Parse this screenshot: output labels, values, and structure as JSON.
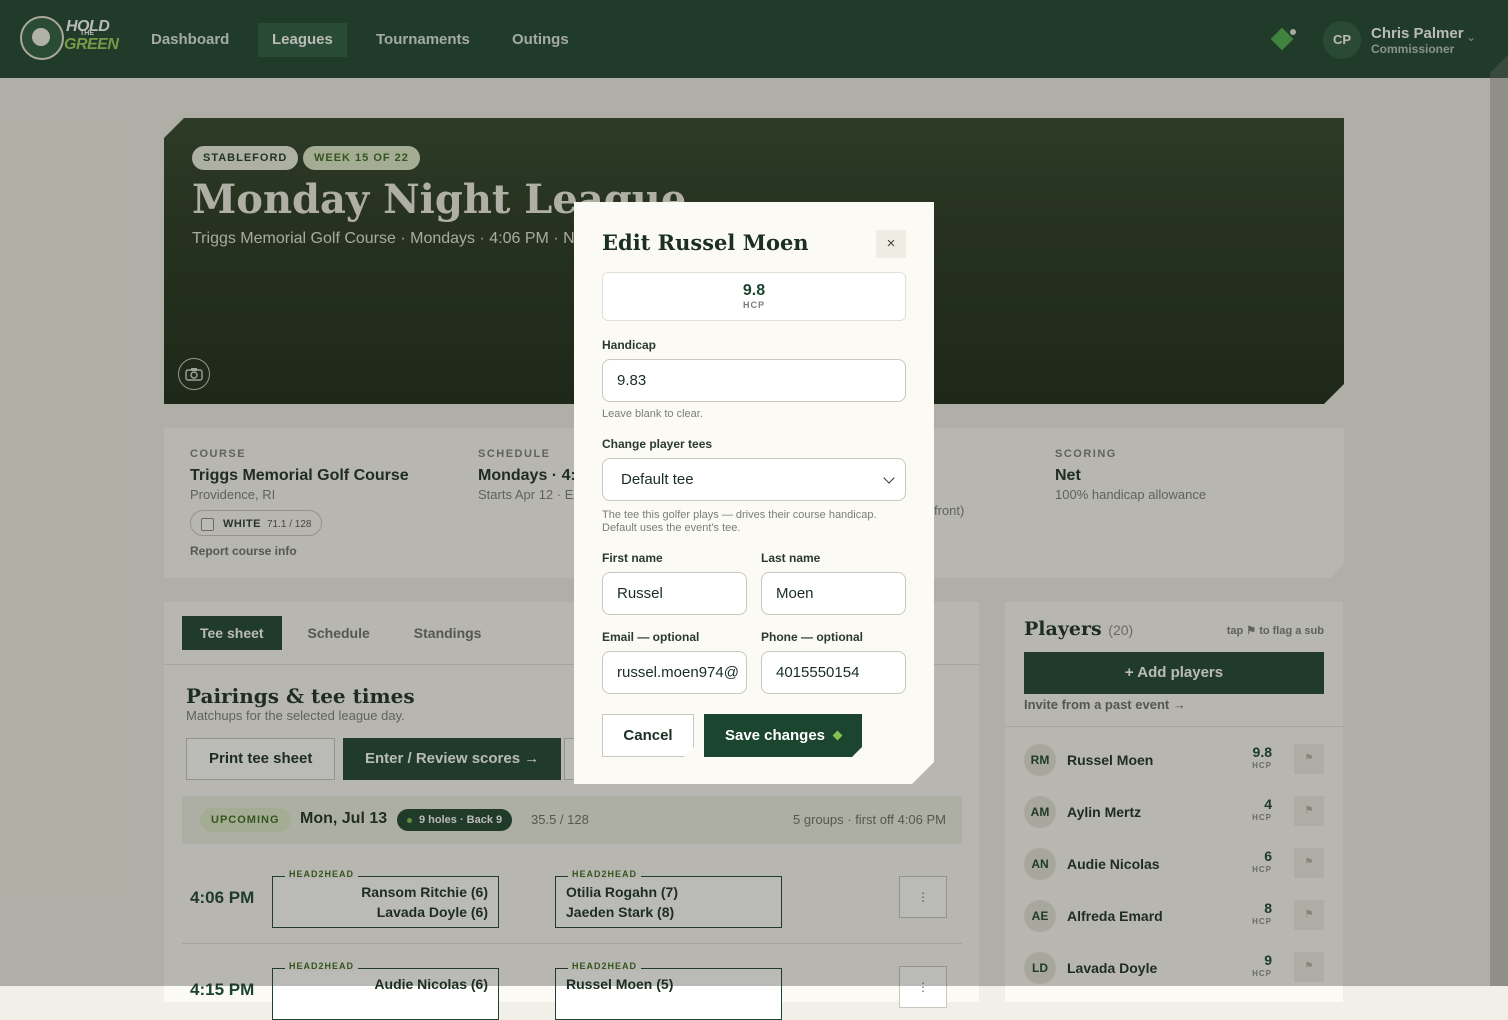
{
  "nav": {
    "logo_line1": "HOLD",
    "logo_line2": "THE",
    "logo_line3": "GREEN",
    "links": [
      "Dashboard",
      "Leagues",
      "Tournaments",
      "Outings"
    ],
    "active": "Leagues",
    "user_initials": "CP",
    "user_name": "Chris Palmer",
    "user_role": "Commissioner"
  },
  "hero": {
    "format_pill": "STABLEFORD",
    "week_pill": "WEEK 15 OF 22",
    "title": "Monday Night League",
    "subtitle": "Triggs Memorial Golf Course · Mondays · 4:06 PM · N"
  },
  "info": {
    "course_label": "COURSE",
    "course_name": "Triggs Memorial Golf Course",
    "course_location": "Providence, RI",
    "tee_name": "WHITE",
    "tee_rating": "71.1 / 128",
    "report_link": "Report course info",
    "schedule_label": "SCHEDULE",
    "schedule_value": "Mondays · 4:",
    "schedule_sub": "Starts Apr 12 · E",
    "holes_peek": "front)",
    "scoring_label": "SCORING",
    "scoring_value": "Net",
    "scoring_sub": "100% handicap allowance"
  },
  "main": {
    "tabs": [
      "Tee sheet",
      "Schedule",
      "Standings"
    ],
    "active_tab": "Tee sheet",
    "section_title": "Pairings & tee times",
    "section_sub": "Matchups for the selected league day.",
    "print_button": "Print tee sheet",
    "enter_button": "Enter / Review scores →",
    "day": {
      "status": "UPCOMING",
      "date": "Mon, Jul 13",
      "holes": "9 holes · Back 9",
      "rating": "35.5 / 128",
      "summary": "5 groups · first off 4:06 PM"
    },
    "tee_times": [
      {
        "time": "4:06 PM",
        "matches": [
          {
            "tag": "HEAD2HEAD",
            "p1": "Ransom Ritchie (6)",
            "p2": "Lavada Doyle (6)"
          },
          {
            "tag": "HEAD2HEAD",
            "p1": "Otilia Rogahn (7)",
            "p2": "Jaeden Stark (8)"
          }
        ],
        "menu": "⋮"
      },
      {
        "time": "4:15 PM",
        "matches": [
          {
            "tag": "HEAD2HEAD",
            "p1": "Audie Nicolas (6)",
            "p2": ""
          },
          {
            "tag": "HEAD2HEAD",
            "p1": "Russel Moen (5)",
            "p2": ""
          }
        ],
        "menu": "⋮"
      }
    ]
  },
  "players": {
    "title": "Players",
    "count": "(20)",
    "hint": "tap ⚑ to flag a sub",
    "add_button": "+ Add players",
    "invite_link": "Invite from a past event →",
    "hcp_label": "HCP",
    "list": [
      {
        "initials": "RM",
        "name": "Russel Moen",
        "hcp": "9.8"
      },
      {
        "initials": "AM",
        "name": "Aylin Mertz",
        "hcp": "4"
      },
      {
        "initials": "AN",
        "name": "Audie Nicolas",
        "hcp": "6"
      },
      {
        "initials": "AE",
        "name": "Alfreda Emard",
        "hcp": "8"
      },
      {
        "initials": "LD",
        "name": "Lavada Doyle",
        "hcp": "9"
      }
    ]
  },
  "modal": {
    "title": "Edit Russel Moen",
    "close": "×",
    "hcp_value": "9.8",
    "hcp_label": "HCP",
    "handicap_label": "Handicap",
    "handicap_value": "9.83",
    "handicap_hint": "Leave blank to clear.",
    "tees_label": "Change player tees",
    "tees_value": "Default tee",
    "tees_hint": "The tee this golfer plays — drives their course handicap. Default uses the event's tee.",
    "first_label": "First name",
    "first_value": "Russel",
    "last_label": "Last name",
    "last_value": "Moen",
    "email_label": "Email — optional",
    "email_value": "russel.moen974@",
    "phone_label": "Phone — optional",
    "phone_value": "4015550154",
    "cancel_button": "Cancel",
    "save_button": "Save changes"
  },
  "colors": {
    "brand": "#1c4530",
    "accent": "#7fc24f",
    "background": "#f1efe7"
  }
}
